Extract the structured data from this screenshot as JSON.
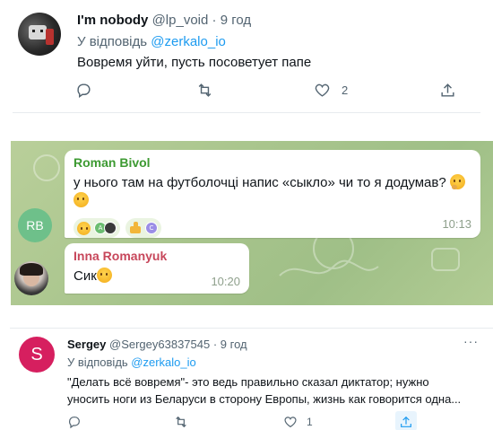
{
  "tweet1": {
    "author_name": "I'm nobody",
    "author_handle": "@lp_void",
    "separator": " · ",
    "time": "9 год",
    "reply_prefix": "У відповідь ",
    "reply_to": "@zerkalo_io",
    "text": "Вовремя уйти, пусть посоветует папе",
    "likes": "2",
    "icons": [
      "reply-icon",
      "retweet-icon",
      "like-icon",
      "share-icon"
    ]
  },
  "telegram": {
    "messages": [
      {
        "sender": "Roman Bivol",
        "sender_color": "#3d9a32",
        "text": "у нього там на футболочці напис «сыкло» чи то я додумав?",
        "time": "10:13",
        "avatar_initials": "RB",
        "avatar_color": "#6ec08a",
        "reactions": [
          {
            "emoji": "grin-emoji",
            "users": [
              "A",
              "avatar-photo"
            ]
          },
          {
            "emoji": "thumbs-up-emoji",
            "users": [
              "C"
            ]
          }
        ]
      },
      {
        "sender": "Inna Romanyuk",
        "sender_color": "#c7475b",
        "text": "Сик",
        "time": "10:20"
      }
    ]
  },
  "tweet2": {
    "avatar_letter": "S",
    "avatar_color": "#d61f5f",
    "author_name": "Sergey",
    "author_handle": "@Sergey63837545",
    "separator": " · ",
    "time": "9 год",
    "more": "···",
    "reply_prefix": "У відповідь ",
    "reply_to": "@zerkalo_io",
    "text_line1": "\"Делать всё вовремя\"- это ведь правильно сказал диктатор; нужно",
    "text_line2": "уносить ноги из Беларуси в сторону Европы, жизнь как говорится одна...",
    "likes": "1"
  },
  "colors": {
    "link": "#1d9bf0",
    "muted": "#536471",
    "telegram_bg": "#a9c58d"
  }
}
